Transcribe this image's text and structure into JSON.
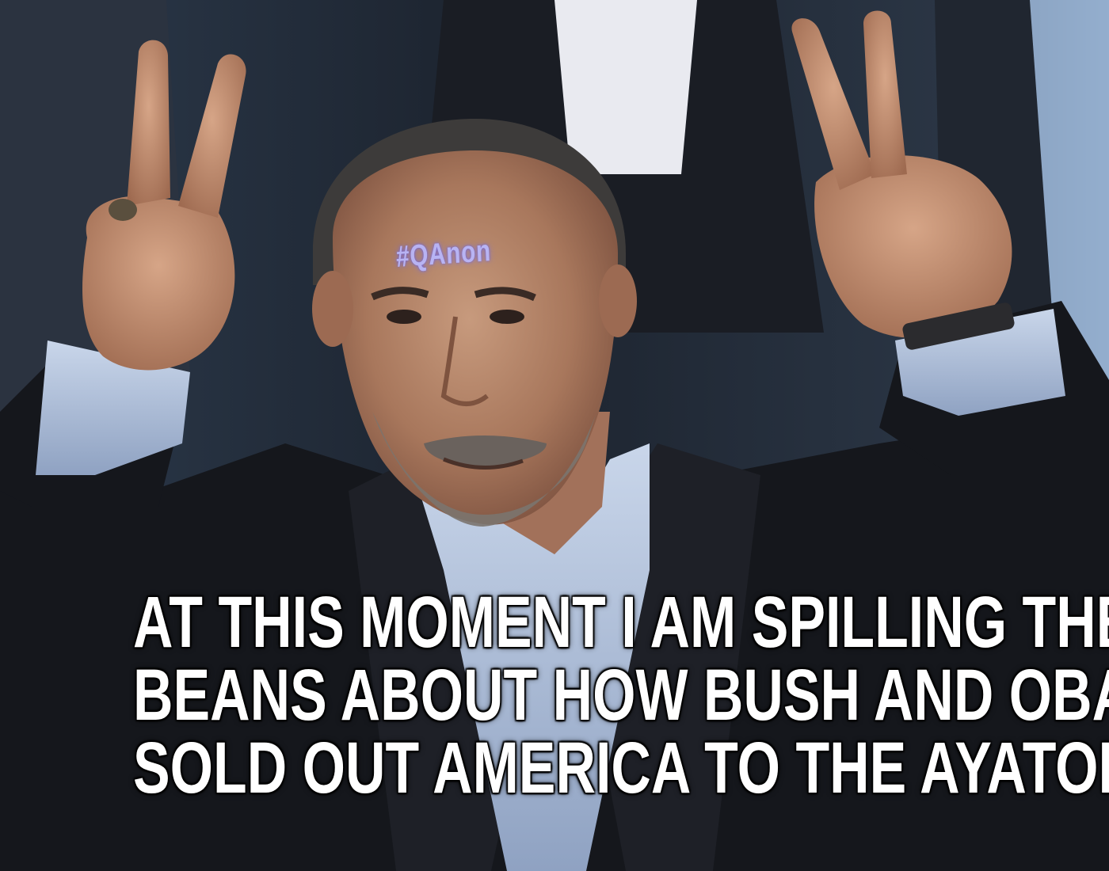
{
  "meme": {
    "forehead_text": "#QAnon",
    "caption_lines": [
      "AT THIS MOMENT I AM SPILLING THE",
      "BEANS ABOUT HOW BUSH AND OBAMA",
      "SOLD OUT AMERICA TO THE AYATOLLA"
    ]
  },
  "colors": {
    "caption_text": "#ffffff",
    "caption_outline": "#000000",
    "forehead_glow": "#b9b8ff",
    "background_blue": "#7a98bd",
    "suit": "#15171c"
  }
}
